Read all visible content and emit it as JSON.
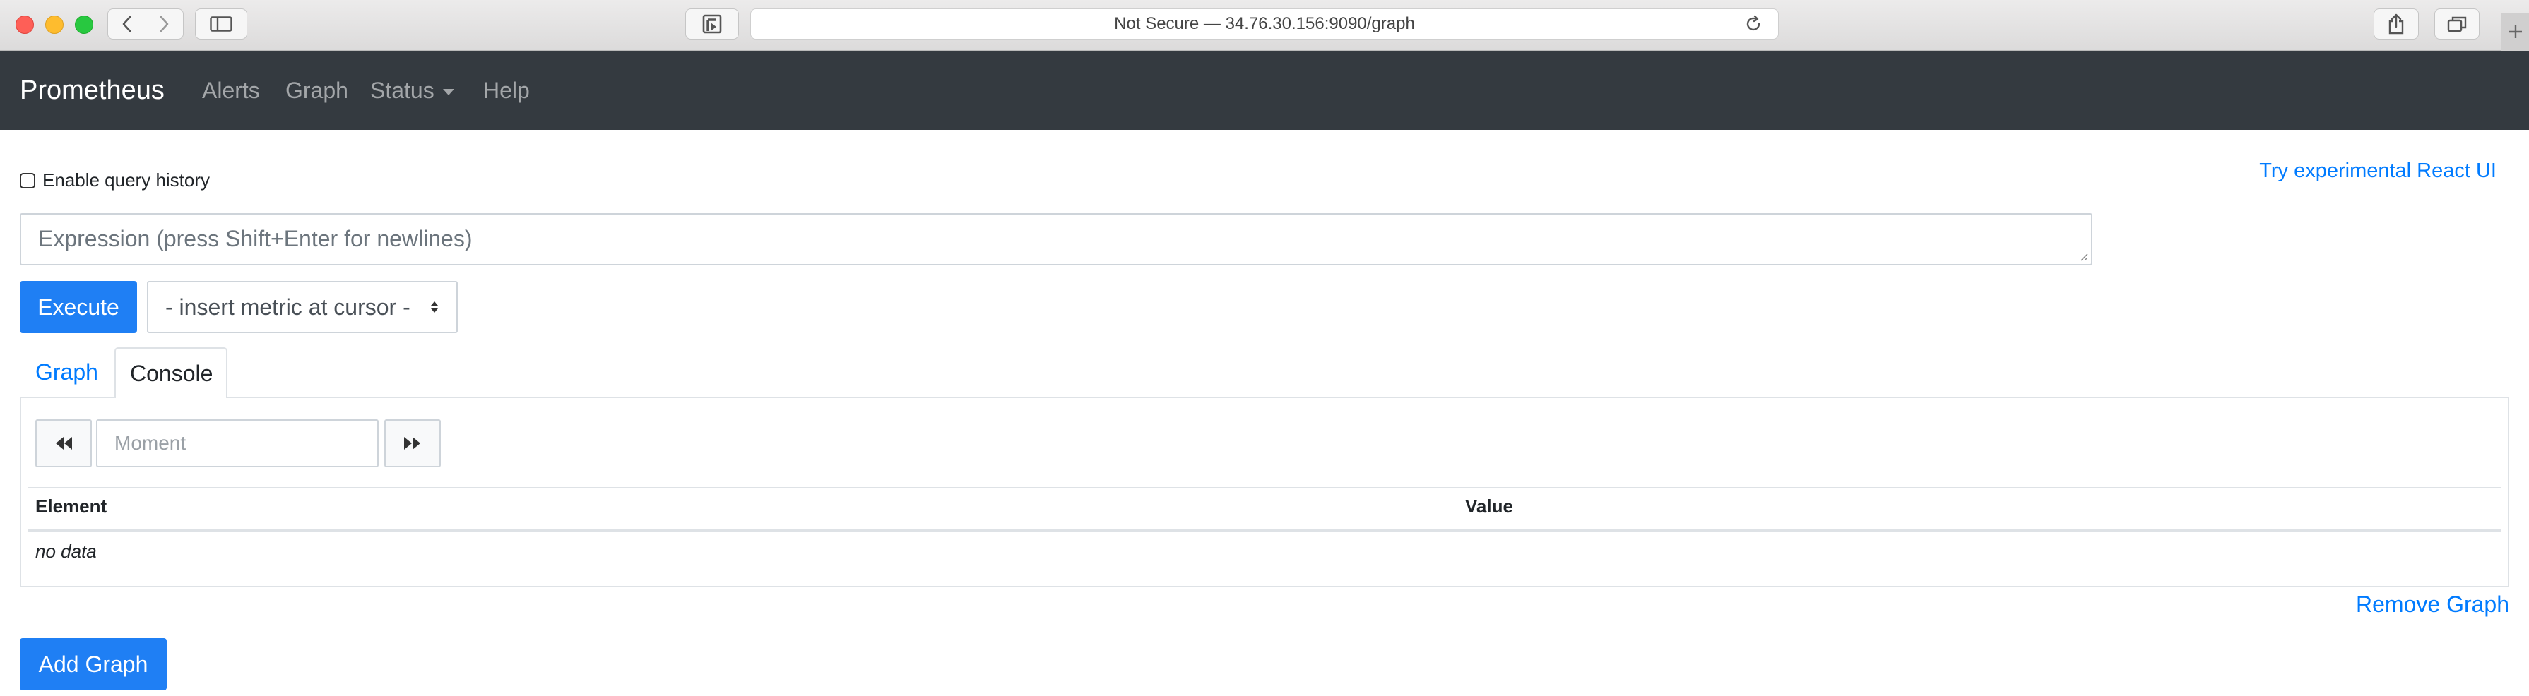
{
  "browser": {
    "address": "Not Secure — 34.76.30.156:9090/graph"
  },
  "navbar": {
    "brand": "Prometheus",
    "links": [
      "Alerts",
      "Graph",
      "Status",
      "Help"
    ]
  },
  "query": {
    "history_label": "Enable query history",
    "history_checked": false,
    "react_link": "Try experimental React UI",
    "expression_placeholder": "Expression (press Shift+Enter for newlines)",
    "execute_label": "Execute",
    "metric_select_value": "- insert metric at cursor -"
  },
  "tabs": [
    "Graph",
    "Console"
  ],
  "active_tab": "Console",
  "console": {
    "moment_placeholder": "Moment",
    "columns": [
      "Element",
      "Value"
    ],
    "empty_text": "no data"
  },
  "actions": {
    "remove_graph": "Remove Graph",
    "add_graph": "Add Graph"
  },
  "colors": {
    "navbar_bg": "#343a40",
    "primary": "#1f7ff4",
    "link": "#007bff"
  }
}
